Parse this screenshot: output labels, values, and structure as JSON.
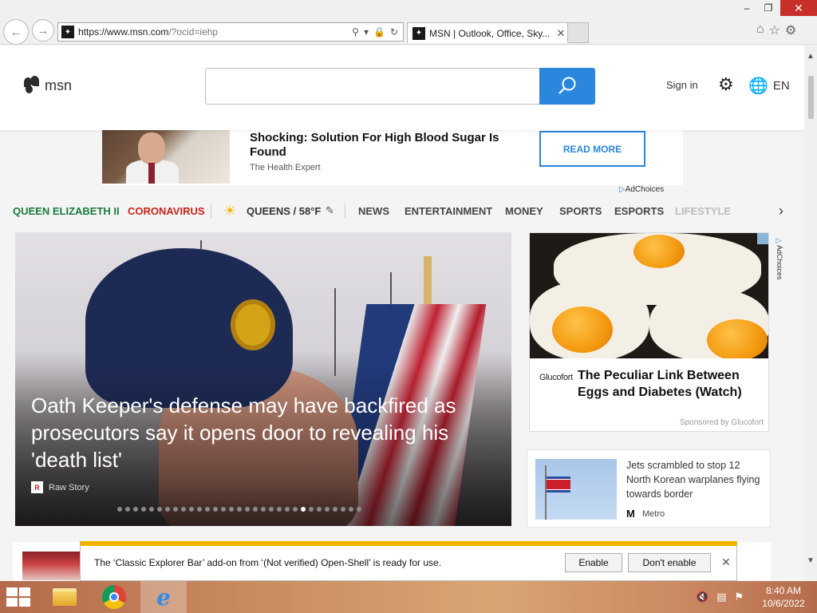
{
  "browser": {
    "url_main": "https://www.msn.com",
    "url_rest": "/?ocid=iehp",
    "tab_title": "MSN | Outlook, Office, Sky...",
    "favicon": "msn-icon"
  },
  "header": {
    "logo_text": "msn",
    "search_placeholder": "",
    "signin": "Sign in",
    "lang": "EN"
  },
  "top_ad": {
    "headline": "Shocking: Solution For High Blood Sugar Is Found",
    "source": "The Health Expert",
    "cta": "READ MORE",
    "adchoices": "AdChoices"
  },
  "nav": {
    "queen": "QUEEN ELIZABETH II",
    "corona": "CORONAVIRUS",
    "weather": "QUEENS / 58°F",
    "items": [
      "NEWS",
      "ENTERTAINMENT",
      "MONEY",
      "SPORTS",
      "ESPORTS",
      "LIFESTYLE"
    ]
  },
  "hero": {
    "title": "Oath Keeper's defense may have backfired as prosecutors say it opens door to revealing his 'death list'",
    "source": "Raw Story",
    "slide_count": 31,
    "active_slide": 23
  },
  "side_ad": {
    "brand": "Glucofort",
    "title": "The Peculiar Link Between Eggs and Diabetes (Watch)",
    "sponsored": "Sponsored by Glucofort",
    "adchoices": "AdChoices"
  },
  "side_news": {
    "title": "Jets scrambled to stop 12 North Korean warplanes flying towards border",
    "source": "Metro"
  },
  "notification": {
    "text": "The ‘Classic Explorer Bar’ add-on from ‘(Not verified) Open-Shell’ is ready for use.",
    "enable": "Enable",
    "dont_enable": "Don't enable"
  },
  "taskbar": {
    "time": "8:40 AM",
    "date": "10/6/2022"
  },
  "colors": {
    "accent": "#2b86de",
    "queen": "#1b7a3a",
    "corona": "#c8231a",
    "notify_bar": "#f0b400"
  }
}
